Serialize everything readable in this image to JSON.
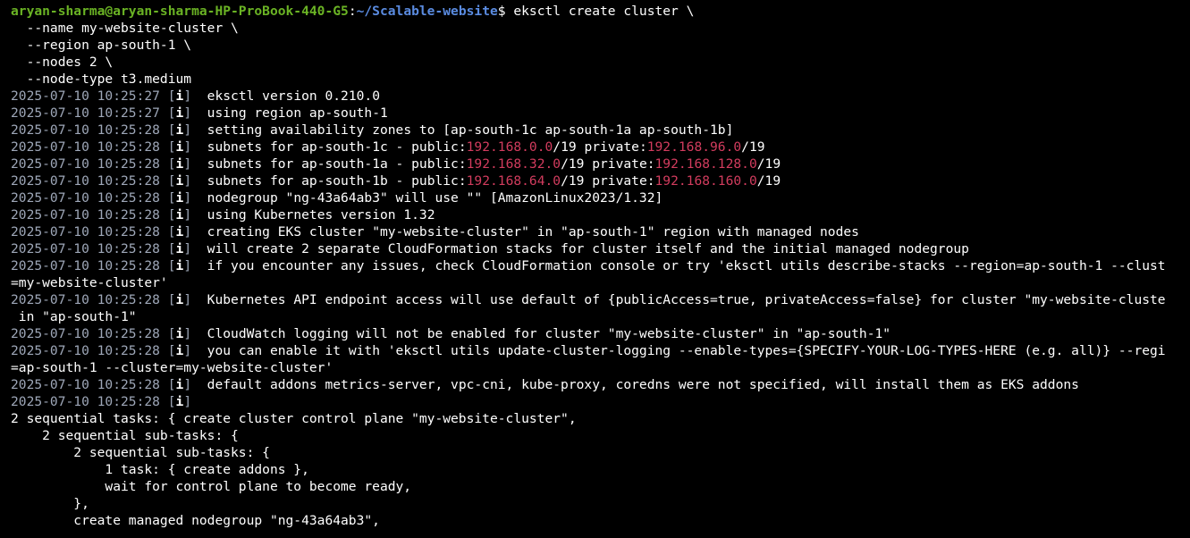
{
  "theme": {
    "background": "#000000",
    "text": "#ffffff",
    "user_host": "#6ab324",
    "path": "#5a8be0",
    "timestamp": "#9ea7b8",
    "ip_address": "#d23c5e"
  },
  "terminal": {
    "lines": [
      {
        "segments": [
          {
            "c": "user",
            "t": "aryan-sharma@aryan-sharma-HP-ProBook-440-G5"
          },
          {
            "c": "white",
            "t": ":"
          },
          {
            "c": "path",
            "t": "~/Scalable-website"
          },
          {
            "c": "white",
            "t": "$ eksctl create cluster \\"
          }
        ]
      },
      {
        "segments": [
          {
            "c": "white",
            "t": "  --name my-website-cluster \\"
          }
        ]
      },
      {
        "segments": [
          {
            "c": "white",
            "t": "  --region ap-south-1 \\"
          }
        ]
      },
      {
        "segments": [
          {
            "c": "white",
            "t": "  --nodes 2 \\"
          }
        ]
      },
      {
        "segments": [
          {
            "c": "white",
            "t": "  --node-type t3.medium"
          }
        ]
      },
      {
        "segments": [
          {
            "c": "ts",
            "t": "2025-07-10 10:25:27 ["
          },
          {
            "c": "i",
            "t": "i"
          },
          {
            "c": "ts",
            "t": "]"
          },
          {
            "c": "white",
            "t": "  eksctl version 0.210.0"
          }
        ]
      },
      {
        "segments": [
          {
            "c": "ts",
            "t": "2025-07-10 10:25:27 ["
          },
          {
            "c": "i",
            "t": "i"
          },
          {
            "c": "ts",
            "t": "]"
          },
          {
            "c": "white",
            "t": "  using region ap-south-1"
          }
        ]
      },
      {
        "segments": [
          {
            "c": "ts",
            "t": "2025-07-10 10:25:28 ["
          },
          {
            "c": "i",
            "t": "i"
          },
          {
            "c": "ts",
            "t": "]"
          },
          {
            "c": "white",
            "t": "  setting availability zones to [ap-south-1c ap-south-1a ap-south-1b]"
          }
        ]
      },
      {
        "segments": [
          {
            "c": "ts",
            "t": "2025-07-10 10:25:28 ["
          },
          {
            "c": "i",
            "t": "i"
          },
          {
            "c": "ts",
            "t": "]"
          },
          {
            "c": "white",
            "t": "  subnets for ap-south-1c - public:"
          },
          {
            "c": "ip",
            "t": "192.168.0.0"
          },
          {
            "c": "white",
            "t": "/19 private:"
          },
          {
            "c": "ip",
            "t": "192.168.96.0"
          },
          {
            "c": "white",
            "t": "/19"
          }
        ]
      },
      {
        "segments": [
          {
            "c": "ts",
            "t": "2025-07-10 10:25:28 ["
          },
          {
            "c": "i",
            "t": "i"
          },
          {
            "c": "ts",
            "t": "]"
          },
          {
            "c": "white",
            "t": "  subnets for ap-south-1a - public:"
          },
          {
            "c": "ip",
            "t": "192.168.32.0"
          },
          {
            "c": "white",
            "t": "/19 private:"
          },
          {
            "c": "ip",
            "t": "192.168.128.0"
          },
          {
            "c": "white",
            "t": "/19"
          }
        ]
      },
      {
        "segments": [
          {
            "c": "ts",
            "t": "2025-07-10 10:25:28 ["
          },
          {
            "c": "i",
            "t": "i"
          },
          {
            "c": "ts",
            "t": "]"
          },
          {
            "c": "white",
            "t": "  subnets for ap-south-1b - public:"
          },
          {
            "c": "ip",
            "t": "192.168.64.0"
          },
          {
            "c": "white",
            "t": "/19 private:"
          },
          {
            "c": "ip",
            "t": "192.168.160.0"
          },
          {
            "c": "white",
            "t": "/19"
          }
        ]
      },
      {
        "segments": [
          {
            "c": "ts",
            "t": "2025-07-10 10:25:28 ["
          },
          {
            "c": "i",
            "t": "i"
          },
          {
            "c": "ts",
            "t": "]"
          },
          {
            "c": "white",
            "t": "  nodegroup \"ng-43a64ab3\" will use \"\" [AmazonLinux2023/1.32]"
          }
        ]
      },
      {
        "segments": [
          {
            "c": "ts",
            "t": "2025-07-10 10:25:28 ["
          },
          {
            "c": "i",
            "t": "i"
          },
          {
            "c": "ts",
            "t": "]"
          },
          {
            "c": "white",
            "t": "  using Kubernetes version 1.32"
          }
        ]
      },
      {
        "segments": [
          {
            "c": "ts",
            "t": "2025-07-10 10:25:28 ["
          },
          {
            "c": "i",
            "t": "i"
          },
          {
            "c": "ts",
            "t": "]"
          },
          {
            "c": "white",
            "t": "  creating EKS cluster \"my-website-cluster\" in \"ap-south-1\" region with managed nodes"
          }
        ]
      },
      {
        "segments": [
          {
            "c": "ts",
            "t": "2025-07-10 10:25:28 ["
          },
          {
            "c": "i",
            "t": "i"
          },
          {
            "c": "ts",
            "t": "]"
          },
          {
            "c": "white",
            "t": "  will create 2 separate CloudFormation stacks for cluster itself and the initial managed nodegroup"
          }
        ]
      },
      {
        "segments": [
          {
            "c": "ts",
            "t": "2025-07-10 10:25:28 ["
          },
          {
            "c": "i",
            "t": "i"
          },
          {
            "c": "ts",
            "t": "]"
          },
          {
            "c": "white",
            "t": "  if you encounter any issues, check CloudFormation console or try 'eksctl utils describe-stacks --region=ap-south-1 --clust"
          }
        ]
      },
      {
        "segments": [
          {
            "c": "white",
            "t": "=my-website-cluster'"
          }
        ]
      },
      {
        "segments": [
          {
            "c": "ts",
            "t": "2025-07-10 10:25:28 ["
          },
          {
            "c": "i",
            "t": "i"
          },
          {
            "c": "ts",
            "t": "]"
          },
          {
            "c": "white",
            "t": "  Kubernetes API endpoint access will use default of {publicAccess=true, privateAccess=false} for cluster \"my-website-cluste"
          }
        ]
      },
      {
        "segments": [
          {
            "c": "white",
            "t": " in \"ap-south-1\""
          }
        ]
      },
      {
        "segments": [
          {
            "c": "ts",
            "t": "2025-07-10 10:25:28 ["
          },
          {
            "c": "i",
            "t": "i"
          },
          {
            "c": "ts",
            "t": "]"
          },
          {
            "c": "white",
            "t": "  CloudWatch logging will not be enabled for cluster \"my-website-cluster\" in \"ap-south-1\""
          }
        ]
      },
      {
        "segments": [
          {
            "c": "ts",
            "t": "2025-07-10 10:25:28 ["
          },
          {
            "c": "i",
            "t": "i"
          },
          {
            "c": "ts",
            "t": "]"
          },
          {
            "c": "white",
            "t": "  you can enable it with 'eksctl utils update-cluster-logging --enable-types={SPECIFY-YOUR-LOG-TYPES-HERE (e.g. all)} --regi"
          }
        ]
      },
      {
        "segments": [
          {
            "c": "white",
            "t": "=ap-south-1 --cluster=my-website-cluster'"
          }
        ]
      },
      {
        "segments": [
          {
            "c": "ts",
            "t": "2025-07-10 10:25:28 ["
          },
          {
            "c": "i",
            "t": "i"
          },
          {
            "c": "ts",
            "t": "]"
          },
          {
            "c": "white",
            "t": "  default addons metrics-server, vpc-cni, kube-proxy, coredns were not specified, will install them as EKS addons"
          }
        ]
      },
      {
        "segments": [
          {
            "c": "ts",
            "t": "2025-07-10 10:25:28 ["
          },
          {
            "c": "i",
            "t": "i"
          },
          {
            "c": "ts",
            "t": "]"
          }
        ]
      },
      {
        "segments": [
          {
            "c": "white",
            "t": "2 sequential tasks: { create cluster control plane \"my-website-cluster\","
          }
        ]
      },
      {
        "segments": [
          {
            "c": "white",
            "t": "    2 sequential sub-tasks: {"
          }
        ]
      },
      {
        "segments": [
          {
            "c": "white",
            "t": "        2 sequential sub-tasks: {"
          }
        ]
      },
      {
        "segments": [
          {
            "c": "white",
            "t": "            1 task: { create addons },"
          }
        ]
      },
      {
        "segments": [
          {
            "c": "white",
            "t": "            wait for control plane to become ready,"
          }
        ]
      },
      {
        "segments": [
          {
            "c": "white",
            "t": "        },"
          }
        ]
      },
      {
        "segments": [
          {
            "c": "white",
            "t": "        create managed nodegroup \"ng-43a64ab3\","
          }
        ]
      }
    ]
  }
}
